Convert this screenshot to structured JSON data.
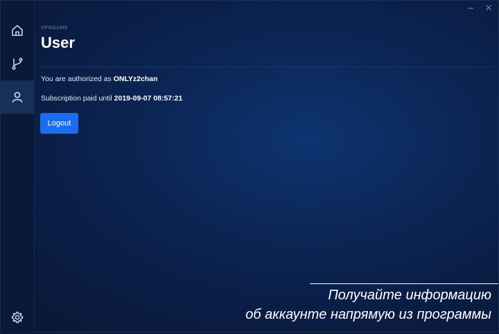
{
  "app": {
    "name": "VPNGAME"
  },
  "page": {
    "title": "User"
  },
  "sidebar": {
    "items": [
      {
        "name": "home",
        "icon": "home-icon",
        "active": false
      },
      {
        "name": "routes",
        "icon": "branch-icon",
        "active": false
      },
      {
        "name": "user",
        "icon": "user-icon",
        "active": true
      }
    ],
    "settings_icon": "gear-icon"
  },
  "user": {
    "auth_prefix": "You are authorized as ",
    "username": "ONLYz2chan",
    "subscription_prefix": "Subscription paid until ",
    "subscription_until": "2019-09-07 08:57:21"
  },
  "actions": {
    "logout_label": "Logout"
  },
  "caption": {
    "line1": "Получайте информацию",
    "line2": "об аккаунте напрямую из программы"
  },
  "colors": {
    "accent": "#1a6df0",
    "background": "#0b2554",
    "sidebar": "#0a1938"
  }
}
